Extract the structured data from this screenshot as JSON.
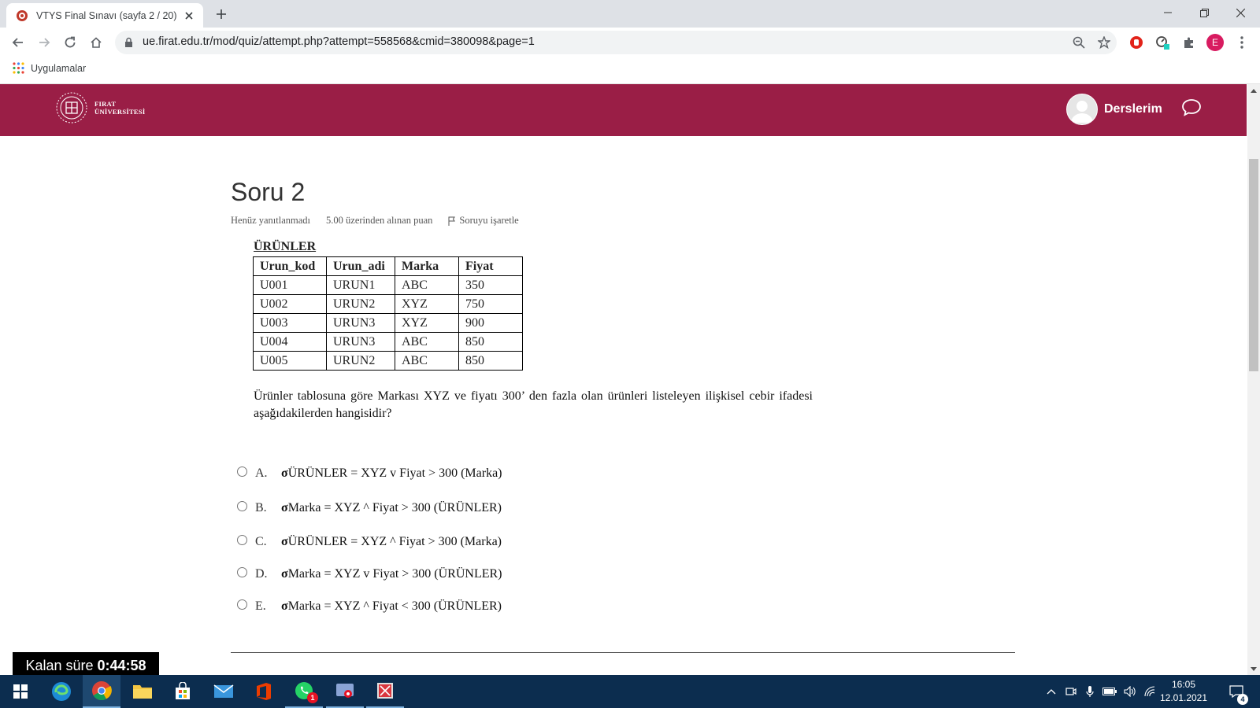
{
  "browser": {
    "tab_title": "VTYS Final Sınavı (sayfa 2 / 20)",
    "url": "ue.firat.edu.tr/mod/quiz/attempt.php?attempt=558568&cmid=380098&page=1",
    "bookmark_apps_label": "Uygulamalar",
    "profile_initial": "E"
  },
  "header": {
    "logo_line1": "FIRAT",
    "logo_line2": "ÜNİVERSİTESİ",
    "user_menu_label": "Derslerim",
    "brand_color": "#9a1e46"
  },
  "question": {
    "title": "Soru 2",
    "status": "Henüz yanıtlanmadı",
    "points": "5.00 üzerinden alınan puan",
    "flag_label": "Soruyu işaretle",
    "table_caption": "ÜRÜNLER",
    "table": {
      "headers": [
        "Urun_kod",
        "Urun_adi",
        "Marka",
        "Fiyat"
      ],
      "rows": [
        [
          "U001",
          "URUN1",
          "ABC",
          "350"
        ],
        [
          "U002",
          "URUN2",
          "XYZ",
          "750"
        ],
        [
          "U003",
          "URUN3",
          "XYZ",
          "900"
        ],
        [
          "U004",
          "URUN3",
          "ABC",
          "850"
        ],
        [
          "U005",
          "URUN2",
          "ABC",
          "850"
        ]
      ]
    },
    "text": "Ürünler tablosuna göre Markası XYZ ve fiyatı 300’ den fazla olan ürünleri listeleyen ilişkisel cebir ifadesi aşağıdakilerden hangisidir?",
    "options": [
      {
        "letter": "A.",
        "sigma": "σ",
        "text": "ÜRÜNLER = XYZ v Fiyat > 300 (Marka)"
      },
      {
        "letter": "B.",
        "sigma": "σ",
        "text": "Marka = XYZ ^ Fiyat > 300 (ÜRÜNLER)"
      },
      {
        "letter": "C.",
        "sigma": "σ",
        "text": "ÜRÜNLER = XYZ ^ Fiyat > 300 (Marka)"
      },
      {
        "letter": "D.",
        "sigma": "σ",
        "text": "Marka = XYZ v Fiyat > 300 (ÜRÜNLER)"
      },
      {
        "letter": "E.",
        "sigma": "σ",
        "text": "Marka = XYZ ^ Fiyat < 300 (ÜRÜNLER)"
      }
    ]
  },
  "timer": {
    "label": "Kalan süre",
    "value": "0:44:58"
  },
  "taskbar": {
    "time": "16:05",
    "date": "12.01.2021",
    "whatsapp_badge": "1",
    "notification_badge": "4"
  }
}
